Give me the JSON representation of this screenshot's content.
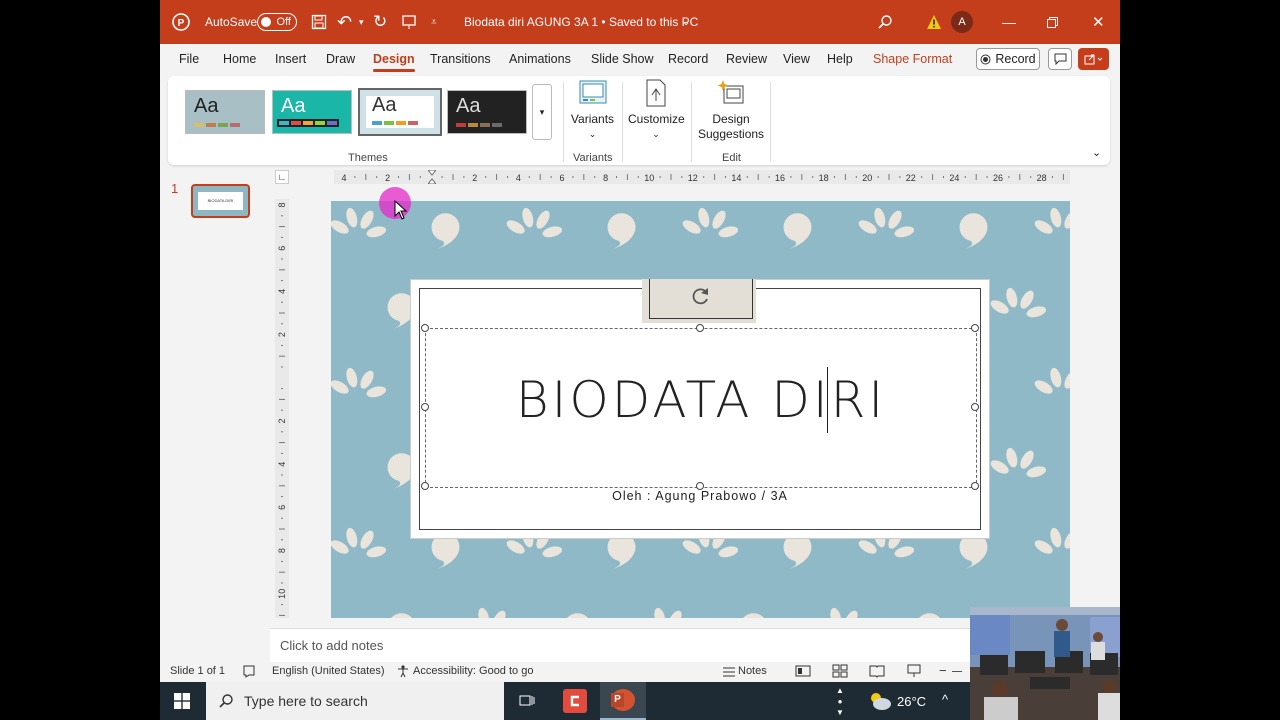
{
  "titlebar": {
    "autosave_label": "AutoSave",
    "autosave_state": "Off",
    "document_title": "Biodata diri AGUNG 3A 1 • Saved to this PC",
    "avatar_initial": "A"
  },
  "menu": {
    "tabs": [
      "File",
      "Home",
      "Insert",
      "Draw",
      "Design",
      "Transitions",
      "Animations",
      "Slide Show",
      "Record",
      "Review",
      "View",
      "Help",
      "Shape Format"
    ],
    "active_tab": "Design",
    "record_button": "Record"
  },
  "ribbon": {
    "themes_label": "Themes",
    "theme_sample": "Aa",
    "variants_button": "Variants",
    "variants_label": "Variants",
    "customize_button": "Customize",
    "design_suggestions_line1": "Design",
    "design_suggestions_line2": "Suggestions",
    "edit_label": "Edit"
  },
  "thumbnails": {
    "slide_number": "1",
    "thumb_text": "BIODATA DIRI"
  },
  "rulers": {
    "h_labels": [
      "4",
      "2",
      "",
      "2",
      "4",
      "6",
      "8",
      "10",
      "12",
      "14",
      "16",
      "18",
      "20",
      "22",
      "24",
      "26",
      "28"
    ],
    "v_labels": [
      "8",
      "6",
      "4",
      "2",
      "",
      "2",
      "4",
      "6",
      "8",
      "10"
    ]
  },
  "slide": {
    "title": "BIODATA DIRI",
    "subtitle": "Oleh : Agung Prabowo / 3A"
  },
  "notes": {
    "placeholder": "Click to add notes"
  },
  "status": {
    "slide_count": "Slide 1 of 1",
    "language": "English (United States)",
    "accessibility": "Accessibility: Good to go",
    "notes_button": "Notes"
  },
  "taskbar": {
    "search_placeholder": "Type here to search",
    "temperature": "26°C"
  },
  "colors": {
    "accent": "#c43e1c",
    "slide_background": "#8fb9c6"
  }
}
